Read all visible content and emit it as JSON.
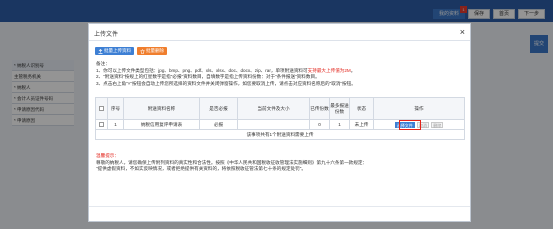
{
  "background": {
    "tabs": [
      {
        "label": "我的资料",
        "badge": "1"
      },
      {
        "label": "保存"
      },
      {
        "label": "首页"
      },
      {
        "label": "下一步"
      }
    ],
    "right_button": "提交",
    "form_rows": [
      "* 纳税人识别号",
      "主管税务机关",
      "* 纳税人",
      "* 会计人员证件号码",
      "* 申请原因代码",
      "* 申请原因"
    ]
  },
  "modal": {
    "title": "上传文件",
    "close_glyph": "×",
    "btn_upload_all": "批量上传资料",
    "btn_batch_delete": "批量删除",
    "notes": {
      "heading": "备注：",
      "line1_pre": "1、你可以上传文件类型包括：jpg、bmp、png、pdf、xls、xlsx、doc、docx、zip、rar，单项附送资料可",
      "line1_red": "支持最大上传值为2M",
      "line1_post": "。",
      "line2": "2、\"附送资料\"按规上的红星数字是指\"必报\"资料数目，自填数字是指上传资料份数：对于\"条件报送\"资料数目。",
      "line3": "3、点击右上角\"×\"按钮会自动上传您所选择的资料文件并关闭弹窗操作，如您要取消上传，请点击对应资料名称后的\"取消\"按钮。"
    },
    "table": {
      "headers": [
        "",
        "序号",
        "附送资料名称",
        "是否必报",
        "当前文件及大小",
        "已传份数",
        "最多报送份数",
        "状态",
        "操作"
      ],
      "rows": [
        {
          "seq": "1",
          "name": "纳税信用复评申请表",
          "required": "必报",
          "file": "",
          "uploaded": "0",
          "max": "1",
          "status": "未上传",
          "ops": [
            "选择文件",
            "取消",
            "删除"
          ]
        }
      ],
      "summary": "该事项共有1个附送资料需要上传"
    },
    "warning": {
      "title": "温馨提示：",
      "line1": "尊敬的纳税人，请您确保上传附列资料的真实性和合法性。按照《中华人民共和国税收征收管理法实施细则》第九十六条第一款规定：",
      "line2": "\"提供虚假资料，不如实反映情况，或者拒绝提供有关资料的，将依照税收征管法第七十条的规定处罚\"。"
    }
  }
}
